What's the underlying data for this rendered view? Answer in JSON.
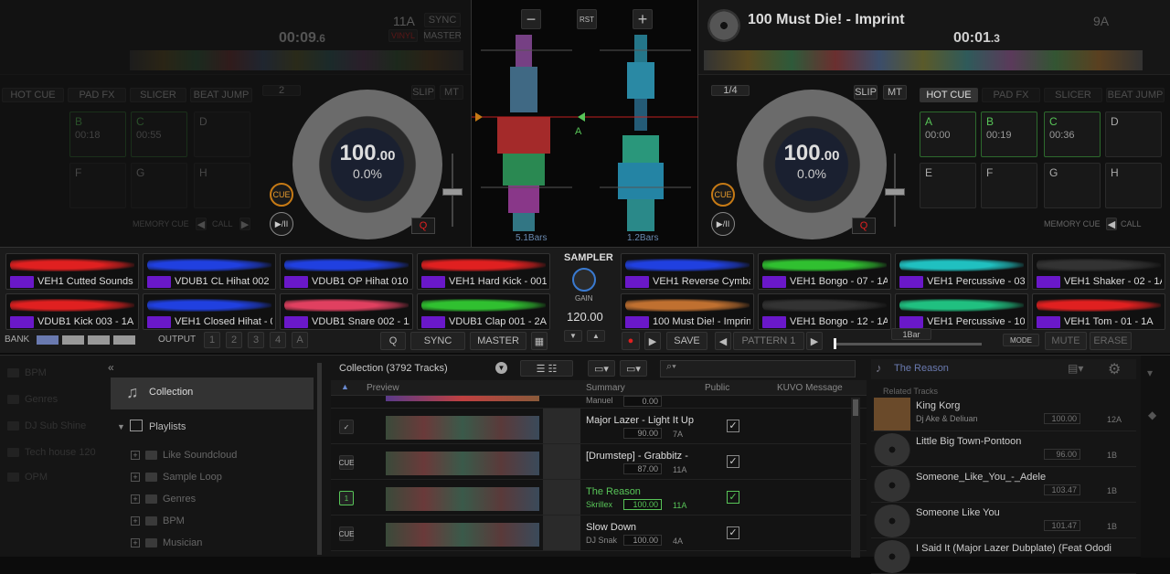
{
  "deckA": {
    "key": "11A",
    "sync": "SYNC",
    "vinyl": "VINYL",
    "master": "MASTER",
    "time_main": "00:09",
    "time_frac": ".6",
    "hotcue_tab": "HOT CUE",
    "padfx_tab": "PAD FX",
    "slicer_tab": "SLICER",
    "beatjump_tab": "BEAT JUMP",
    "beatloop": "2",
    "slip": "SLIP",
    "mt": "MT",
    "pads": [
      {
        "letter": "B",
        "time": "00:18"
      },
      {
        "letter": "C",
        "time": "00:55"
      },
      {
        "letter": "D",
        "time": ""
      },
      {
        "letter": "F",
        "time": ""
      },
      {
        "letter": "G",
        "time": ""
      },
      {
        "letter": "H",
        "time": ""
      }
    ],
    "memory_cue": "MEMORY CUE",
    "call": "CALL",
    "bpm_int": "100",
    "bpm_dec": ".00",
    "pitch": "0.0%",
    "cue": "CUE",
    "play": "▶/II",
    "q": "Q"
  },
  "center": {
    "minus": "−",
    "rst": "RST",
    "plus": "+",
    "bars_left": "5.1Bars",
    "bars_right": "1.2Bars",
    "marker_a": "A"
  },
  "deckB": {
    "title": "100 Must Die! - Imprint",
    "key": "9A",
    "time_main": "00:01",
    "time_frac": ".3",
    "beatloop": "1/4",
    "slip": "SLIP",
    "mt": "MT",
    "hotcue_tab": "HOT CUE",
    "padfx_tab": "PAD FX",
    "slicer_tab": "SLICER",
    "beatjump_tab": "BEAT JUMP",
    "pads": [
      {
        "letter": "A",
        "time": "00:00"
      },
      {
        "letter": "B",
        "time": "00:19"
      },
      {
        "letter": "C",
        "time": "00:36"
      },
      {
        "letter": "D",
        "time": ""
      },
      {
        "letter": "E",
        "time": ""
      },
      {
        "letter": "F",
        "time": ""
      },
      {
        "letter": "G",
        "time": ""
      },
      {
        "letter": "H",
        "time": ""
      }
    ],
    "memory_cue": "MEMORY CUE",
    "call": "CALL",
    "bpm_int": "100",
    "bpm_dec": ".00",
    "pitch": "0.0%",
    "cue": "CUE",
    "play": "▶/II",
    "q": "Q"
  },
  "sampler": {
    "title": "SAMPLER",
    "gain": "GAIN",
    "bpm": "120.00",
    "slots": [
      {
        "name": "VEH1 Cutted Sounds ...",
        "color": "#e02020"
      },
      {
        "name": "VDUB1 CL Hihat 002 - ...",
        "color": "#2040e0"
      },
      {
        "name": "VDUB1 OP Hihat 010 ...",
        "color": "#2040e0"
      },
      {
        "name": "VEH1 Hard Kick - 001 ...",
        "color": "#e02020"
      },
      {
        "name": "VEH1 Reverse Cymba...",
        "color": "#2040e0"
      },
      {
        "name": "VEH1 Bongo - 07 - 1A",
        "color": "#30c030"
      },
      {
        "name": "VEH1 Percussive - 03 ...",
        "color": "#20c0c0"
      },
      {
        "name": "VEH1 Shaker - 02 - 1A",
        "color": "#333333"
      },
      {
        "name": "VDUB1 Kick 003 - 1A",
        "color": "#e02020"
      },
      {
        "name": "VEH1 Closed Hihat - 0...",
        "color": "#2040e0"
      },
      {
        "name": "VDUB1 Snare 002 - 1A",
        "color": "#e04060"
      },
      {
        "name": "VDUB1 Clap 001 - 2A",
        "color": "#30c030"
      },
      {
        "name": "100 Must Die! - Imprint",
        "color": "#c07030"
      },
      {
        "name": "VEH1 Bongo - 12 - 1A",
        "color": "#333333"
      },
      {
        "name": "VEH1 Percussive - 10 ...",
        "color": "#20c080"
      },
      {
        "name": "VEH1 Tom - 01 - 1A",
        "color": "#e02020"
      }
    ],
    "bank": "BANK",
    "output": "OUTPUT",
    "outputs": [
      "1",
      "2",
      "3",
      "4",
      "A"
    ],
    "q": "Q",
    "sync": "SYNC",
    "master": "MASTER",
    "save": "SAVE",
    "pattern": "PATTERN 1",
    "length": "1Bar",
    "mode": "MODE",
    "mute": "MUTE",
    "erase": "ERASE"
  },
  "browser": {
    "tree": [
      {
        "label": "BPM",
        "type": "folder"
      },
      {
        "label": "Genres",
        "type": "folder"
      },
      {
        "label": "DJ Sub Shine",
        "type": "folder"
      },
      {
        "label": "Tech house  120",
        "type": "folder"
      },
      {
        "label": "OPM",
        "type": "folder"
      }
    ],
    "collection": "Collection",
    "playlists": "Playlists",
    "playlist_items": [
      "Like Soundcloud",
      "Sample Loop",
      "Genres",
      "BPM",
      "Musician"
    ],
    "list_title": "Collection (3792 Tracks)",
    "col_preview": "Preview",
    "col_summary": "Summary",
    "col_public": "Public",
    "col_kuvo": "KUVO Message",
    "rows": [
      {
        "title": "",
        "artist": "Manuel",
        "bpm": "0.00",
        "key": "",
        "state": "",
        "checked": false
      },
      {
        "title": "Major Lazer - Light It Up",
        "artist": "",
        "bpm": "90.00",
        "key": "7A",
        "state": "✓",
        "checked": true
      },
      {
        "title": "[Drumstep] - Grabbitz -",
        "artist": "",
        "bpm": "87.00",
        "key": "11A",
        "state": "CUE",
        "checked": true
      },
      {
        "title": "The Reason",
        "artist": "Skrillex",
        "bpm": "100.00",
        "key": "11A",
        "state": "1",
        "checked": true
      },
      {
        "title": "Slow Down",
        "artist": "DJ Snak",
        "bpm": "100.00",
        "key": "4A",
        "state": "CUE",
        "checked": true
      }
    ],
    "related_header": "The Reason",
    "related_label": "Related Tracks",
    "related": [
      {
        "title": "King Korg",
        "artist": "Dj Ake & Deliuan",
        "bpm": "100.00",
        "key": "12A"
      },
      {
        "title": "Little Big Town-Pontoon",
        "artist": "",
        "bpm": "96.00",
        "key": "1B"
      },
      {
        "title": "Someone_Like_You_-_Adele",
        "artist": "",
        "bpm": "103.47",
        "key": "1B"
      },
      {
        "title": "Someone Like You",
        "artist": "",
        "bpm": "101.47",
        "key": "1B"
      },
      {
        "title": "I Said It (Major Lazer Dubplate) (Feat Ododi",
        "artist": "",
        "bpm": "",
        "key": ""
      }
    ]
  },
  "colors": {
    "accent_green": "#58c558",
    "sampler_tag": "#6a18c9",
    "record_red": "#e02020"
  }
}
